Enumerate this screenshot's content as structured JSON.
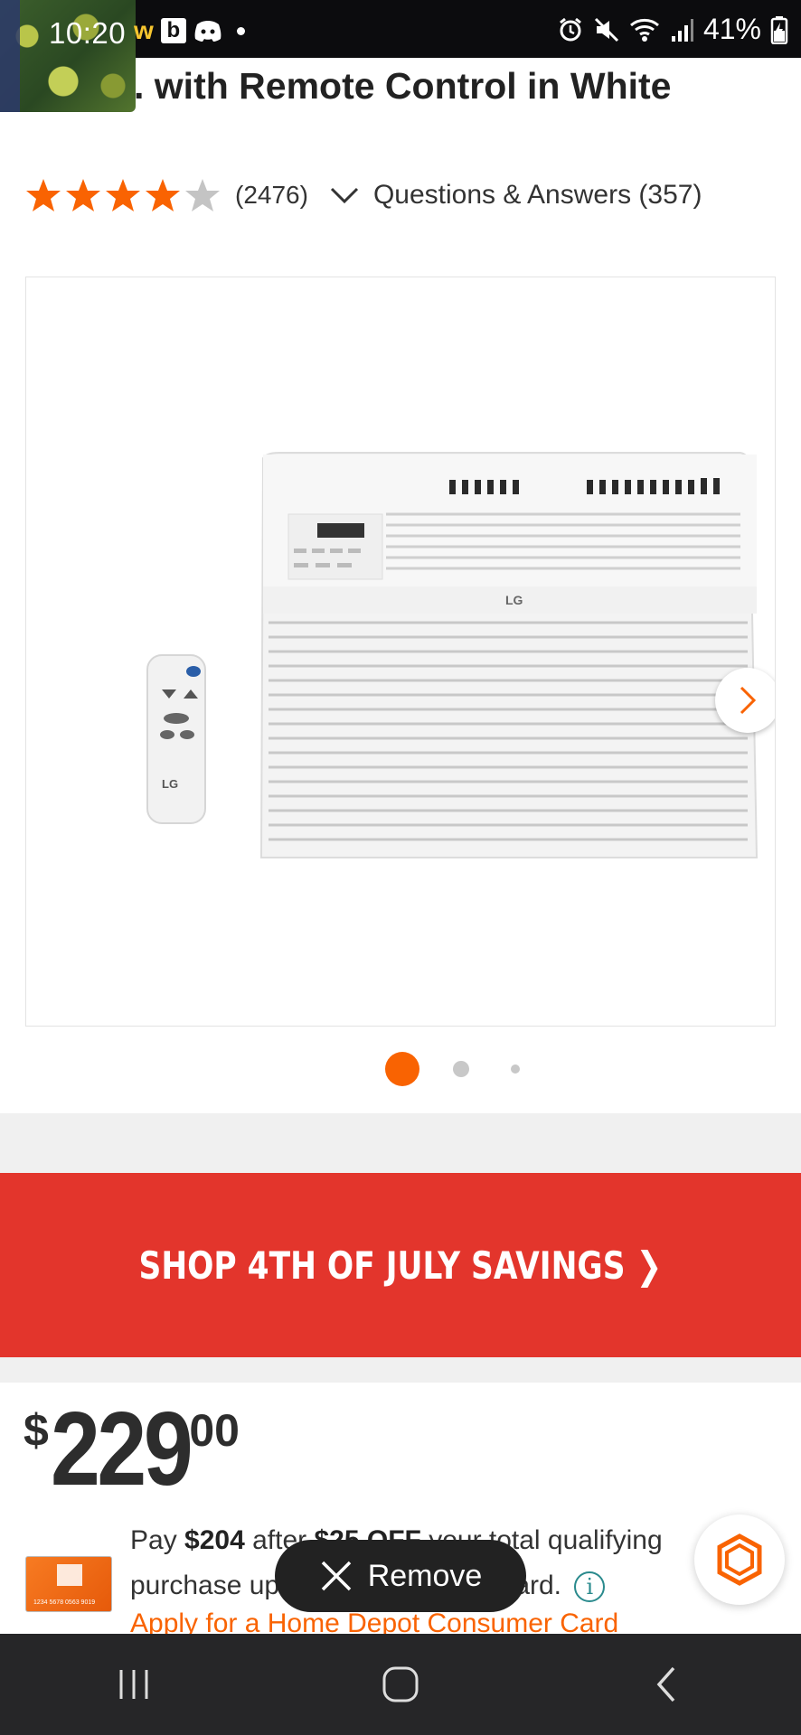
{
  "status_bar": {
    "time": "10:20",
    "battery": "41%",
    "icons": [
      "w-app-icon",
      "b-app-icon",
      "discord-icon",
      "dot-icon",
      "alarm-icon",
      "mute-icon",
      "wifi-icon",
      "signal-icon",
      "battery-icon"
    ]
  },
  "product": {
    "title_partial": ". with Remote Control in White",
    "rating": 4.0,
    "rating_max": 5,
    "review_count": "(2476)",
    "qa_label": "Questions & Answers (357)"
  },
  "gallery": {
    "brand_label": "LG",
    "image_count": 3,
    "active_index": 0
  },
  "promo": {
    "banner_text": "SHOP 4TH OF JULY SAVINGS ❯",
    "color": "#e3352c"
  },
  "price": {
    "symbol": "$",
    "dollars": "229",
    "cents": "00"
  },
  "card_offer": {
    "card_number": "1234 5678 0563 9019",
    "pay_prefix": "Pay ",
    "pay_amount": "$204",
    "pay_mid": " after ",
    "discount": "$25 OFF",
    "pay_suffix": " your total qualifying purchase upon opening a new card.",
    "apply_link": "Apply for a Home Depot Consumer Card"
  },
  "overlay": {
    "remove_label": "Remove"
  },
  "colors": {
    "accent": "#f96302",
    "promo_red": "#e3352c",
    "link_teal": "#2a8a8d"
  }
}
